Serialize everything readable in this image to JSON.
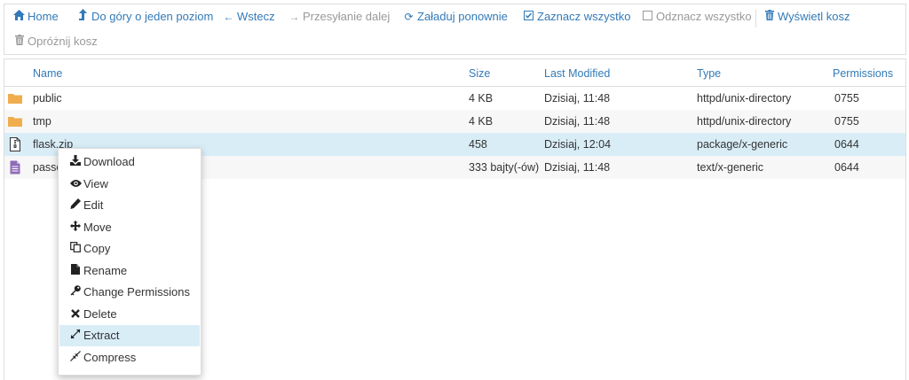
{
  "colors": {
    "link": "#337ab7",
    "disabled": "#999999",
    "folder": "#f0ad4e",
    "zip_icon": "#333333",
    "doc_icon": "#8e6bb7",
    "selected_row": "#d9edf7",
    "header_text": "#337ab7"
  },
  "toolbar": {
    "home": "Home",
    "up": "Do góry o jeden poziom",
    "back": "Wstecz",
    "forward": "Przesyłanie dalej",
    "reload": "Załaduj ponownie",
    "select_all": "Zaznacz wszystko",
    "deselect_all": "Odznacz wszystko",
    "show_trash": "Wyświetl kosz",
    "empty_trash": "Opróżnij kosz"
  },
  "table": {
    "headers": {
      "name": "Name",
      "size": "Size",
      "modified": "Last Modified",
      "type": "Type",
      "permissions": "Permissions"
    },
    "rows": [
      {
        "icon": "folder-icon",
        "name": "public",
        "size": "4 KB",
        "modified": "Dzisiaj, 11:48",
        "type": "httpd/unix-directory",
        "perms": "0755"
      },
      {
        "icon": "folder-icon",
        "name": "tmp",
        "size": "4 KB",
        "modified": "Dzisiaj, 11:48",
        "type": "httpd/unix-directory",
        "perms": "0755"
      },
      {
        "icon": "zip-file-icon",
        "name": "flask.zip",
        "size": "458",
        "modified": "Dzisiaj, 12:04",
        "type": "package/x-generic",
        "perms": "0644",
        "selected": true
      },
      {
        "icon": "text-file-icon",
        "name": "passe",
        "size": "333 bajty(-ów)",
        "modified": "Dzisiaj, 11:48",
        "type": "text/x-generic",
        "perms": "0644"
      }
    ]
  },
  "context_menu": {
    "items": [
      {
        "label": "Download",
        "icon": "download-icon"
      },
      {
        "label": "View",
        "icon": "eye-icon"
      },
      {
        "label": "Edit",
        "icon": "pencil-icon"
      },
      {
        "label": "Move",
        "icon": "move-icon"
      },
      {
        "label": "Copy",
        "icon": "copy-icon"
      },
      {
        "label": "Rename",
        "icon": "file-icon"
      },
      {
        "label": "Change Permissions",
        "icon": "key-icon"
      },
      {
        "label": "Delete",
        "icon": "close-icon"
      },
      {
        "label": "Extract",
        "icon": "expand-icon",
        "highlighted": true
      },
      {
        "label": "Compress",
        "icon": "compress-icon"
      }
    ]
  }
}
